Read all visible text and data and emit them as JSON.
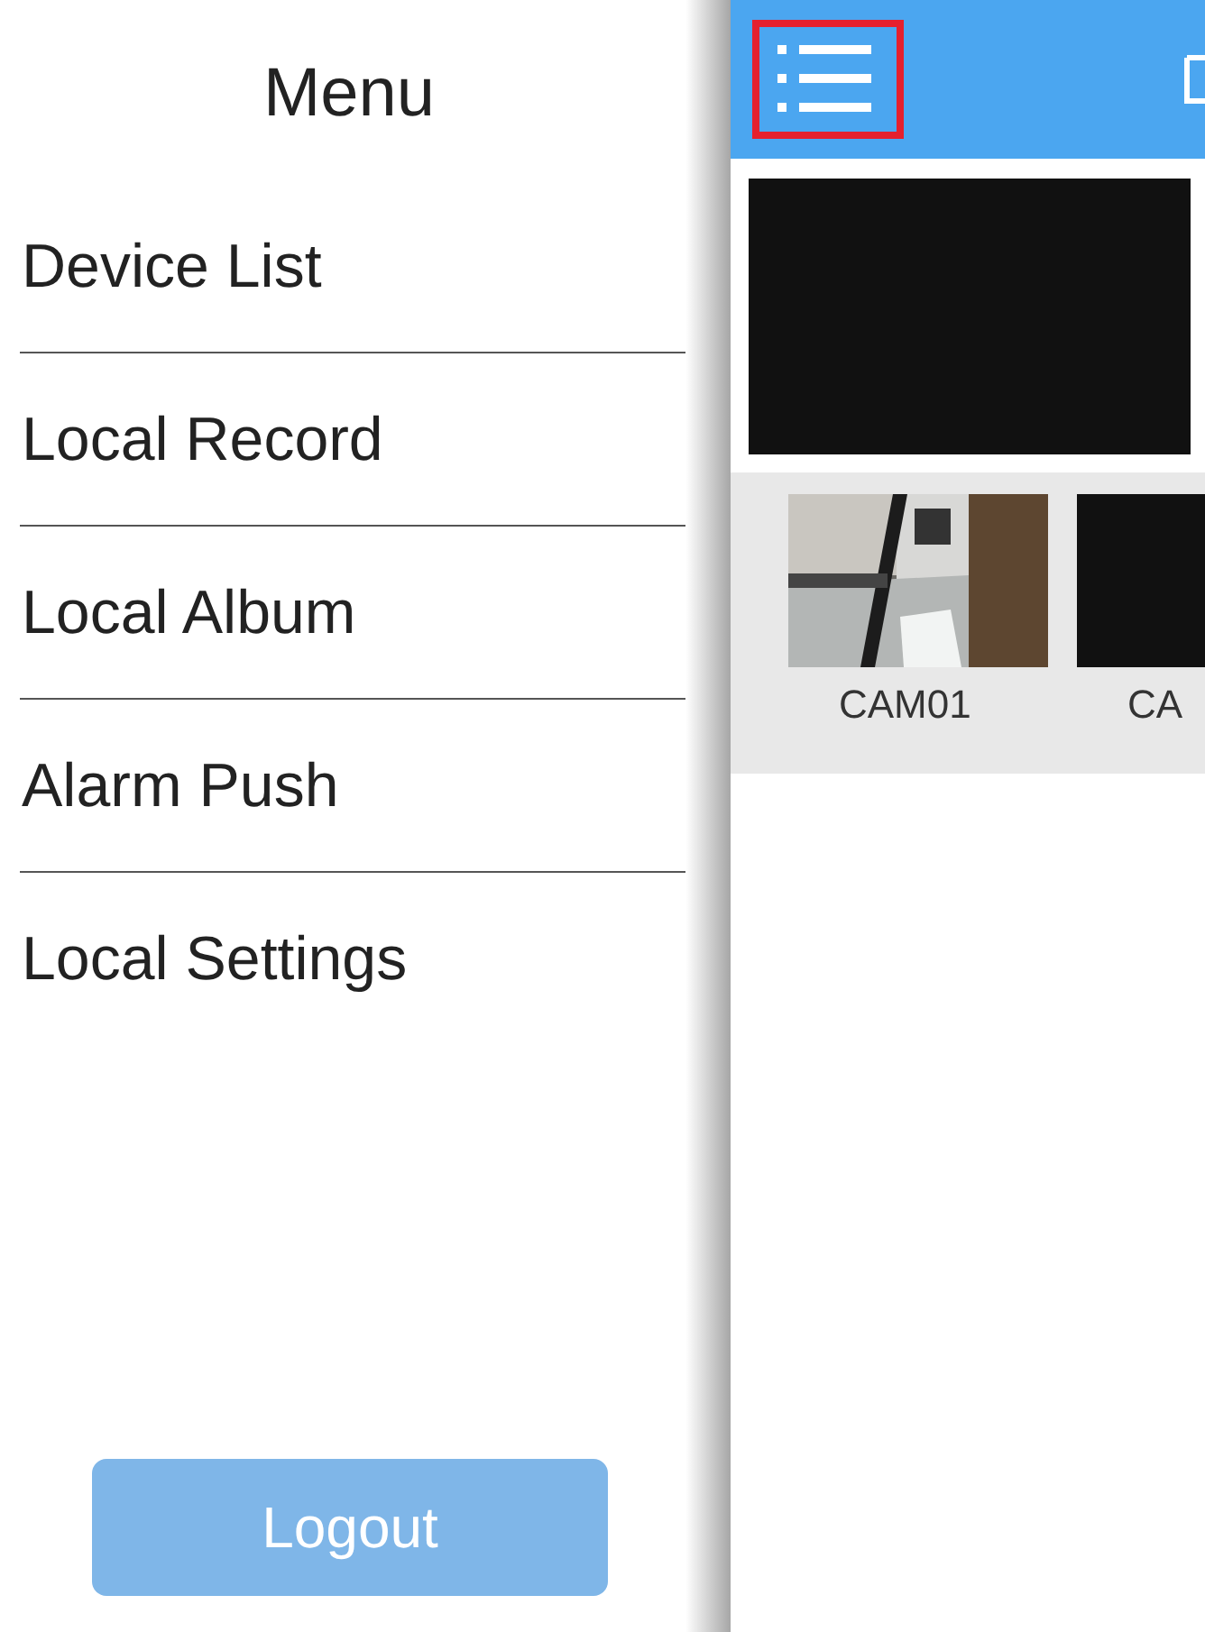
{
  "menu": {
    "title": "Menu",
    "items": [
      {
        "label": "Device List"
      },
      {
        "label": "Local Record"
      },
      {
        "label": "Local Album"
      },
      {
        "label": "Alarm Push"
      },
      {
        "label": "Local Settings"
      }
    ],
    "logout": "Logout"
  },
  "header": {
    "menu_button": {
      "highlighted": true
    }
  },
  "cameras": [
    {
      "label": "CAM01",
      "kind": "picture"
    },
    {
      "label": "CA",
      "kind": "blank"
    }
  ]
}
